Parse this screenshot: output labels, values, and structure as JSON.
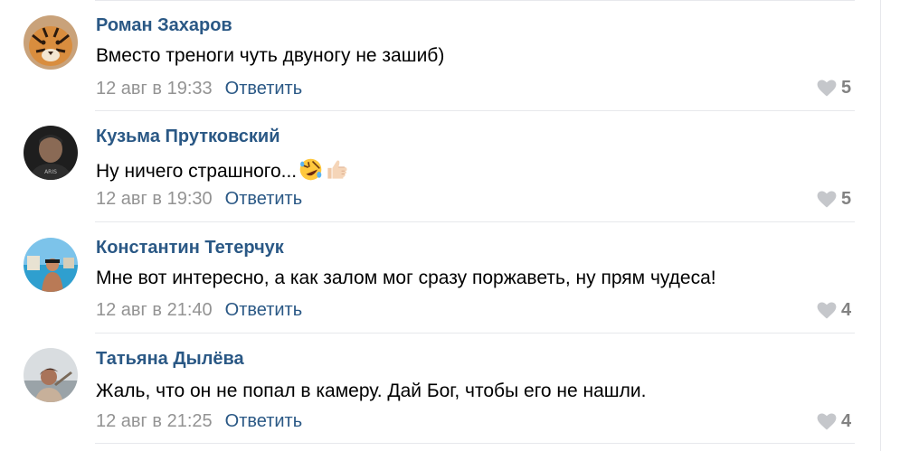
{
  "comments": [
    {
      "author": "Роман Захаров",
      "text": "Вместо треноги чуть двуногу не зашиб)",
      "date": "12 авг в 19:33",
      "reply_label": "Ответить",
      "likes": "5",
      "avatar_icon": "tiger-avatar"
    },
    {
      "author": "Кузьма Прутковский",
      "text": "Ну ничего страшного...",
      "emojis": [
        "rolling-laughing-emoji",
        "thumbs-up-emoji"
      ],
      "date": "12 авг в 19:30",
      "reply_label": "Ответить",
      "likes": "5",
      "avatar_icon": "man-avatar"
    },
    {
      "author": "Константин Тетерчук",
      "text": "Мне вот интересно, а как залом мог сразу поржаветь, ну прям чудеса!",
      "date": "12 авг в 21:40",
      "reply_label": "Ответить",
      "likes": "4",
      "avatar_icon": "beach-avatar"
    },
    {
      "author": "Татьяна Дылёва",
      "text": "Жаль, что он не попал в камеру. Дай Бог, чтобы его не нашли.",
      "date": "12 авг в 21:25",
      "reply_label": "Ответить",
      "likes": "4",
      "avatar_icon": "woman-avatar"
    }
  ],
  "colors": {
    "link": "#2a5885",
    "meta": "#939393",
    "like_count": "#828282",
    "heart": "#c5c7cb",
    "divider": "#e7e8ec"
  }
}
